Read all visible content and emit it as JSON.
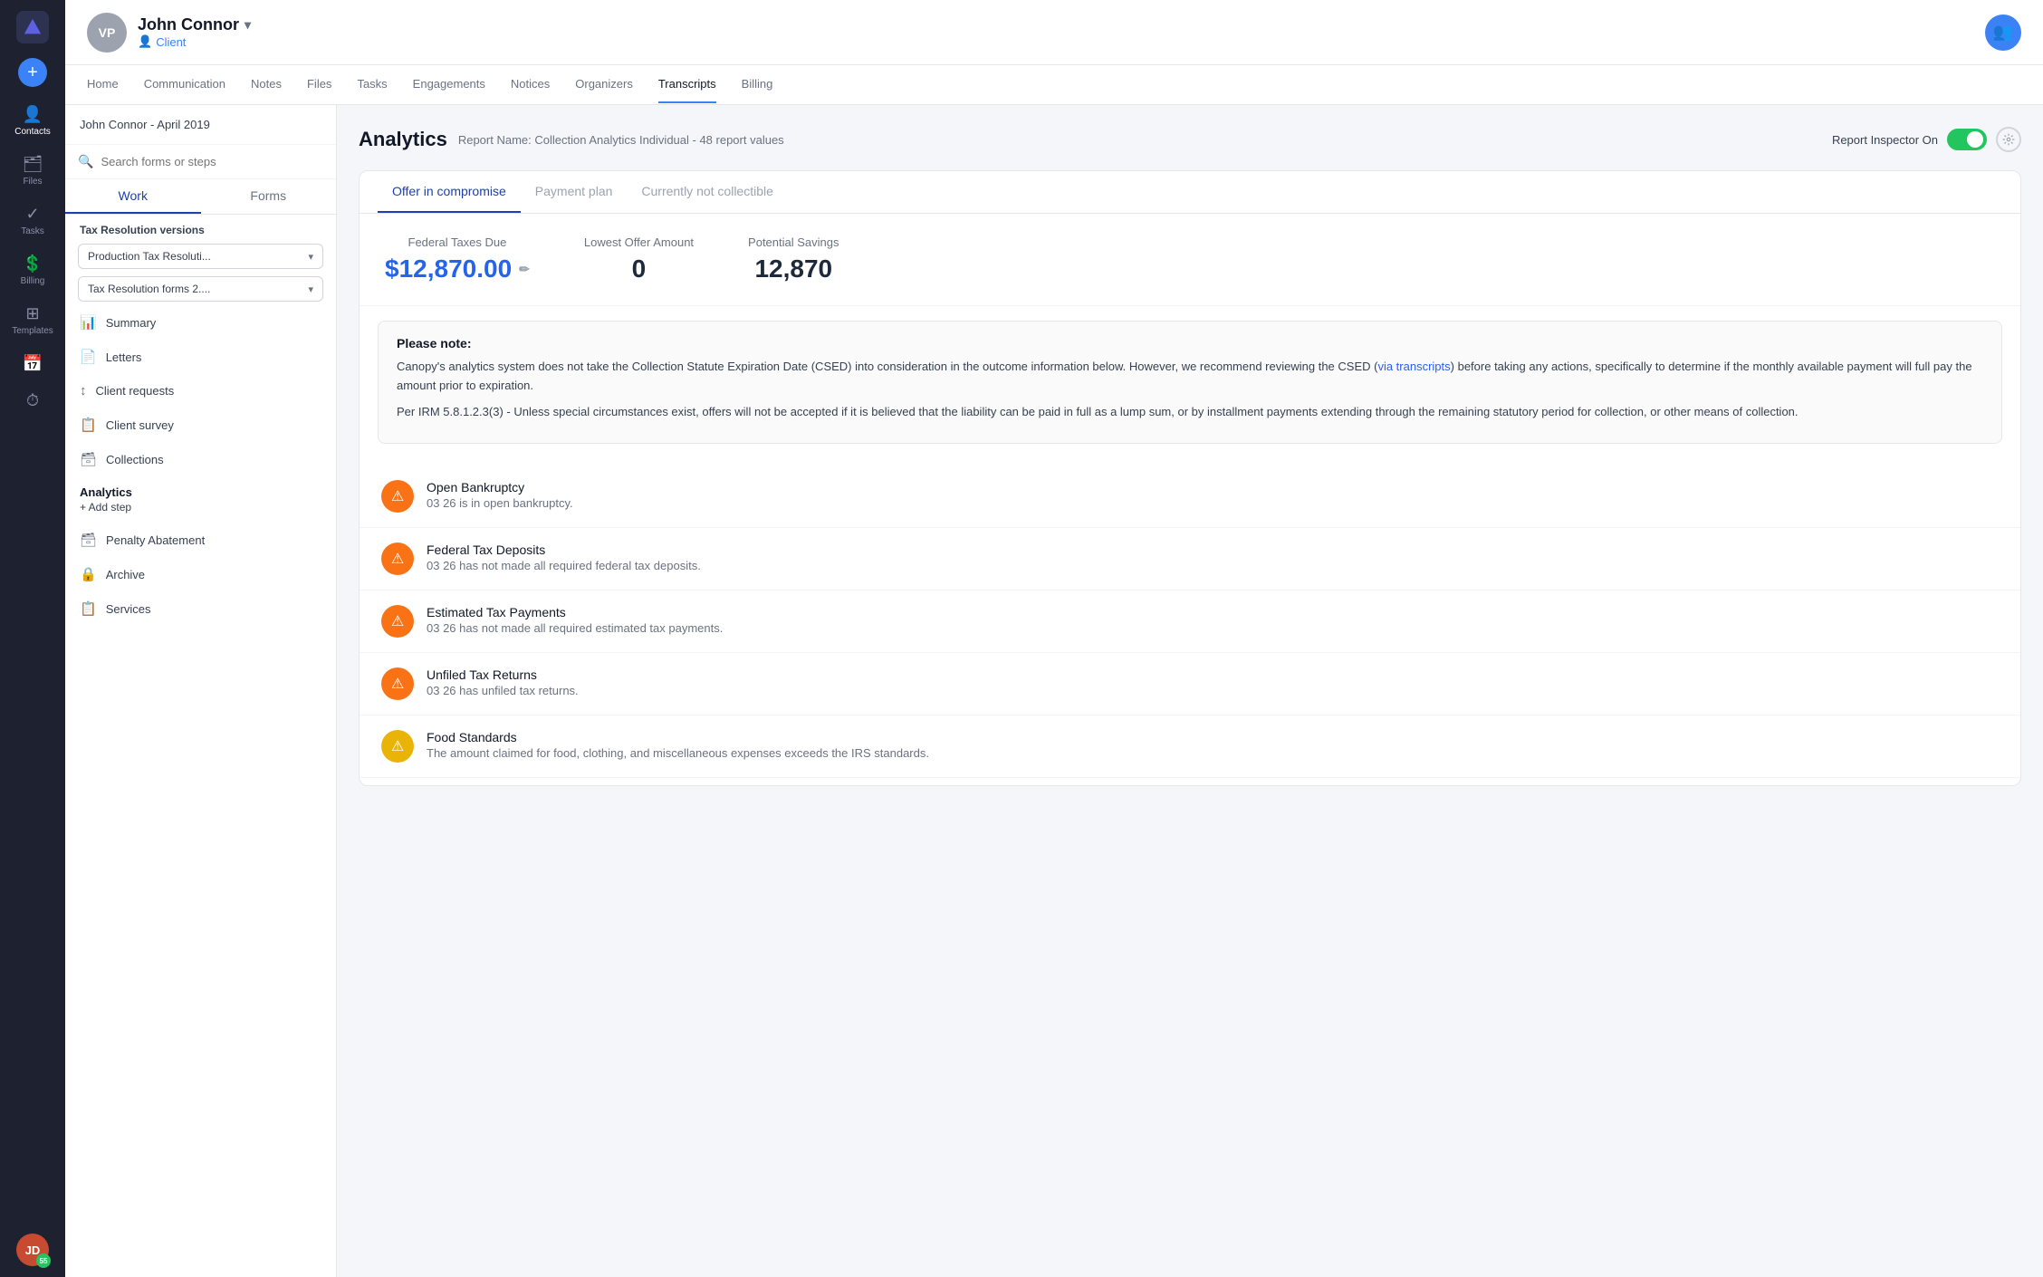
{
  "app": {
    "logo_initials": "▲"
  },
  "nav": {
    "add_btn": "+",
    "items": [
      {
        "id": "contacts",
        "label": "Contacts",
        "icon": "👤",
        "active": true
      },
      {
        "id": "files",
        "label": "Files",
        "icon": "🗂"
      },
      {
        "id": "tasks",
        "label": "Tasks",
        "icon": "✓"
      },
      {
        "id": "billing",
        "label": "Billing",
        "icon": "💲"
      },
      {
        "id": "templates",
        "label": "Templates",
        "icon": "⊞"
      },
      {
        "id": "calendar",
        "label": "",
        "icon": "📅"
      },
      {
        "id": "timer",
        "label": "",
        "icon": "⏱"
      }
    ],
    "avatar_initials": "JD",
    "avatar_badge": "55"
  },
  "header": {
    "user_initials": "VP",
    "user_name": "John Connor",
    "chevron": "▾",
    "role_icon": "👤",
    "role_label": "Client",
    "right_icon": "👥"
  },
  "sub_nav": {
    "items": [
      {
        "id": "home",
        "label": "Home"
      },
      {
        "id": "communication",
        "label": "Communication"
      },
      {
        "id": "notes",
        "label": "Notes"
      },
      {
        "id": "files",
        "label": "Files"
      },
      {
        "id": "tasks",
        "label": "Tasks"
      },
      {
        "id": "engagements",
        "label": "Engagements"
      },
      {
        "id": "notices",
        "label": "Notices"
      },
      {
        "id": "organizers",
        "label": "Organizers"
      },
      {
        "id": "transcripts",
        "label": "Transcripts",
        "active": true
      },
      {
        "id": "billing",
        "label": "Billing"
      }
    ]
  },
  "sidebar": {
    "client_header": "John Connor - April 2019",
    "search_placeholder": "Search forms or steps",
    "tabs": [
      {
        "id": "work",
        "label": "Work",
        "active": true
      },
      {
        "id": "forms",
        "label": "Forms"
      }
    ],
    "version_section": "Tax Resolution versions",
    "dropdown1": "Production Tax Resoluti...",
    "dropdown2": "Tax Resolution forms 2....",
    "menu_items": [
      {
        "id": "summary",
        "label": "Summary",
        "icon": "📊"
      },
      {
        "id": "letters",
        "label": "Letters",
        "icon": "📄"
      },
      {
        "id": "client-requests",
        "label": "Client requests",
        "icon": "↕"
      },
      {
        "id": "client-survey",
        "label": "Client survey",
        "icon": "📋"
      },
      {
        "id": "collections",
        "label": "Collections",
        "icon": "🗃"
      }
    ],
    "analytics_label": "Analytics",
    "add_step_label": "+ Add step",
    "menu_items2": [
      {
        "id": "penalty-abatement",
        "label": "Penalty Abatement",
        "icon": "🗃"
      },
      {
        "id": "archive",
        "label": "Archive",
        "icon": "🔒"
      },
      {
        "id": "services",
        "label": "Services",
        "icon": "📋"
      }
    ]
  },
  "analytics": {
    "title": "Analytics",
    "report_name": "Report Name: Collection Analytics Individual - 48 report values",
    "report_inspector_label": "Report Inspector On",
    "tabs": [
      {
        "id": "offer-in-compromise",
        "label": "Offer in compromise",
        "active": true
      },
      {
        "id": "payment-plan",
        "label": "Payment plan"
      },
      {
        "id": "currently-not-collectible",
        "label": "Currently not collectible"
      }
    ],
    "summary": {
      "federal_taxes_due_label": "Federal Taxes Due",
      "federal_taxes_due_value": "$12,870.00",
      "lowest_offer_label": "Lowest Offer Amount",
      "lowest_offer_value": "0",
      "potential_savings_label": "Potential Savings",
      "potential_savings_value": "12,870"
    },
    "note": {
      "title": "Please note:",
      "text1": "Canopy's analytics system does not take the Collection Statute Expiration Date (CSED) into consideration in the outcome information below. However, we recommend reviewing the CSED (",
      "link_text": "via transcripts",
      "text2": ") before taking any actions, specifically to determine if the monthly available payment will full pay the amount prior to expiration.",
      "text3": "Per IRM 5.8.1.2.3(3) - Unless special circumstances exist, offers will not be accepted if it is believed that the liability can be paid in full as a lump sum, or by installment payments extending through the remaining statutory period for collection, or other means of collection."
    },
    "results": [
      {
        "id": "open-bankruptcy",
        "title": "Open Bankruptcy",
        "desc": "03 26 is in open bankruptcy.",
        "icon_color": "orange"
      },
      {
        "id": "federal-tax-deposits",
        "title": "Federal Tax Deposits",
        "desc": "03 26 has not made all required federal tax deposits.",
        "icon_color": "orange"
      },
      {
        "id": "estimated-tax-payments",
        "title": "Estimated Tax Payments",
        "desc": "03 26 has not made all required estimated tax payments.",
        "icon_color": "orange"
      },
      {
        "id": "unfiled-tax-returns",
        "title": "Unfiled Tax Returns",
        "desc": "03 26 has unfiled tax returns.",
        "icon_color": "orange"
      },
      {
        "id": "food-standards",
        "title": "Food Standards",
        "desc": "The amount claimed for food, clothing, and miscellaneous expenses exceeds the IRS standards.",
        "icon_color": "yellow"
      }
    ]
  }
}
